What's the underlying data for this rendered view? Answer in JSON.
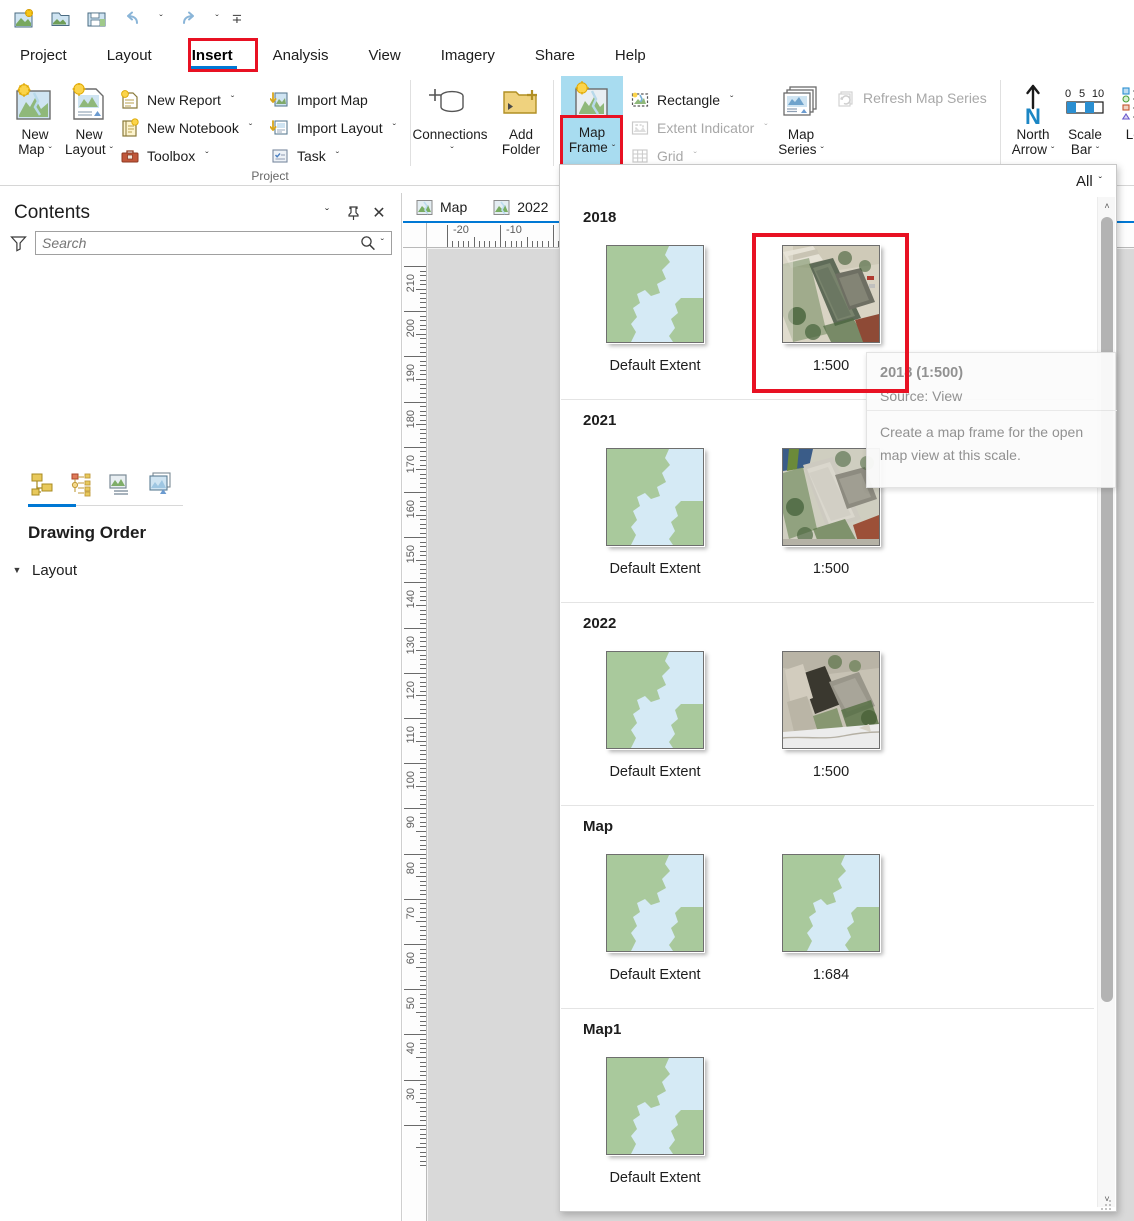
{
  "quick_access": {
    "buttons": [
      {
        "name": "new-project-icon",
        "label": "New Project"
      },
      {
        "name": "open-project-icon",
        "label": "Open Project"
      },
      {
        "name": "save-project-icon",
        "label": "Save Project"
      },
      {
        "name": "undo-icon",
        "label": "Undo"
      },
      {
        "name": "undo-dropdown-caret",
        "label": "ˇ"
      },
      {
        "name": "redo-icon",
        "label": "Redo"
      },
      {
        "name": "redo-dropdown-caret",
        "label": "ˇ"
      },
      {
        "name": "customize-qat-icon",
        "label": "ˇ"
      }
    ]
  },
  "ribbon": {
    "tabs": [
      {
        "label": "Project",
        "active": false
      },
      {
        "label": "Layout",
        "active": false
      },
      {
        "label": "Insert",
        "active": true
      },
      {
        "label": "Analysis",
        "active": false
      },
      {
        "label": "View",
        "active": false
      },
      {
        "label": "Imagery",
        "active": false
      },
      {
        "label": "Share",
        "active": false
      },
      {
        "label": "Help",
        "active": false
      }
    ],
    "active_tab": "Insert",
    "highlight_color": "#e81123",
    "accent_color": "#0078d4",
    "groups": [
      {
        "label": "Project",
        "big_buttons": [
          {
            "label_line1": "New",
            "label_line2": "Map",
            "caret": true,
            "icon": "new-map-icon"
          },
          {
            "label_line1": "New",
            "label_line2": "Layout",
            "caret": true,
            "icon": "new-layout-icon"
          }
        ],
        "small_buttons": [
          {
            "label": "New Report",
            "caret": true,
            "disabled": false,
            "icon": "new-report-icon"
          },
          {
            "label": "New Notebook",
            "caret": true,
            "disabled": false,
            "icon": "new-notebook-icon"
          },
          {
            "label": "Toolbox",
            "caret": true,
            "disabled": false,
            "icon": "toolbox-icon"
          },
          {
            "label": "Import Map",
            "caret": false,
            "disabled": false,
            "icon": "import-map-icon"
          },
          {
            "label": "Import Layout",
            "caret": true,
            "disabled": false,
            "icon": "import-layout-icon"
          },
          {
            "label": "Task",
            "caret": true,
            "disabled": false,
            "icon": "task-icon"
          }
        ]
      },
      {
        "label": "",
        "big_buttons": [
          {
            "label_line1": "Connections",
            "label_line2": "",
            "caret": true,
            "icon": "connections-icon"
          },
          {
            "label_line1": "Add",
            "label_line2": "Folder",
            "caret": false,
            "icon": "add-folder-icon"
          }
        ],
        "small_buttons": []
      },
      {
        "label": "",
        "big_buttons": [
          {
            "label_line1": "Map",
            "label_line2": "Frame",
            "caret": true,
            "icon": "map-frame-icon",
            "selected": true
          }
        ],
        "small_buttons": [
          {
            "label": "Rectangle",
            "caret": true,
            "disabled": false,
            "icon": "rectangle-icon"
          },
          {
            "label": "Extent Indicator",
            "caret": true,
            "disabled": true,
            "icon": "extent-indicator-icon"
          },
          {
            "label": "Grid",
            "caret": true,
            "disabled": true,
            "icon": "grid-icon"
          }
        ]
      },
      {
        "label": "",
        "big_buttons": [
          {
            "label_line1": "Map",
            "label_line2": "Series",
            "caret": true,
            "icon": "map-series-icon"
          }
        ],
        "small_buttons": [
          {
            "label": "Refresh Map Series",
            "caret": false,
            "disabled": true,
            "icon": "refresh-icon"
          }
        ]
      },
      {
        "label": "",
        "big_buttons": [
          {
            "label_line1": "North",
            "label_line2": "Arrow",
            "caret": true,
            "icon": "north-arrow-icon"
          },
          {
            "label_line1": "Scale",
            "label_line2": "Bar",
            "caret": true,
            "icon": "scale-bar-icon"
          },
          {
            "label_line1": "Leg",
            "label_line2": "",
            "caret": true,
            "icon": "legend-icon"
          }
        ],
        "small_buttons": []
      }
    ],
    "scale_bar_ticks": [
      "0",
      "5",
      "10"
    ],
    "north_arrow_letter": "N"
  },
  "contents_pane": {
    "title": "Contents",
    "window_buttons": [
      {
        "name": "menu-chevron-icon",
        "glyph": "ˇ"
      },
      {
        "name": "pin-icon",
        "glyph": "📌"
      },
      {
        "name": "close-icon",
        "glyph": "✕"
      }
    ],
    "search": {
      "placeholder": "Search",
      "value": ""
    },
    "view_tabs": [
      {
        "name": "list-by-drawing-order",
        "active": true
      },
      {
        "name": "list-by-data-source",
        "active": false
      },
      {
        "name": "list-by-selection",
        "active": false
      },
      {
        "name": "list-by-snapping",
        "active": false
      }
    ],
    "section_heading": "Drawing Order",
    "tree": [
      {
        "label": "Layout",
        "expanded": true
      }
    ]
  },
  "view_tabs": [
    {
      "label": "Map",
      "active": false
    },
    {
      "label": "2022",
      "active": true
    }
  ],
  "rulers": {
    "horizontal_labels": [
      "-20",
      "-10"
    ],
    "vertical_labels": [
      "210",
      "200",
      "190",
      "180",
      "170",
      "160",
      "150",
      "140",
      "130",
      "120",
      "110",
      "100",
      "90",
      "80",
      "70",
      "60",
      "50",
      "40",
      "30"
    ],
    "units": "mm"
  },
  "gallery": {
    "filter_label": "All",
    "filter_caret": "ˇ",
    "scroll_up": "˄",
    "scroll_down": "˅",
    "sections": [
      {
        "title": "2018",
        "items": [
          {
            "label": "Default Extent",
            "thumb": "vector-extent"
          },
          {
            "label": "1:500",
            "thumb": "aerial-2018",
            "selected": true
          }
        ]
      },
      {
        "title": "2021",
        "items": [
          {
            "label": "Default Extent",
            "thumb": "vector-extent"
          },
          {
            "label": "1:500",
            "thumb": "aerial-2021"
          }
        ]
      },
      {
        "title": "2022",
        "items": [
          {
            "label": "Default Extent",
            "thumb": "vector-extent"
          },
          {
            "label": "1:500",
            "thumb": "aerial-2022"
          }
        ]
      },
      {
        "title": "Map",
        "items": [
          {
            "label": "Default Extent",
            "thumb": "vector-extent"
          },
          {
            "label": "1:684",
            "thumb": "vector-extent"
          }
        ]
      },
      {
        "title": "Map1",
        "items": [
          {
            "label": "Default Extent",
            "thumb": "vector-extent"
          }
        ]
      }
    ]
  },
  "tooltip": {
    "title": "2018 (1:500)",
    "source": "Source: View",
    "description": "Create a map frame for the open map view at this scale."
  },
  "colors": {
    "accent": "#0078d4",
    "highlight_red": "#e81123",
    "selected_button_bg": "#a8dcf0",
    "map_land": "#a9c99c",
    "map_water": "#d5eaf5",
    "canvas_gray": "#d9d9d9"
  }
}
